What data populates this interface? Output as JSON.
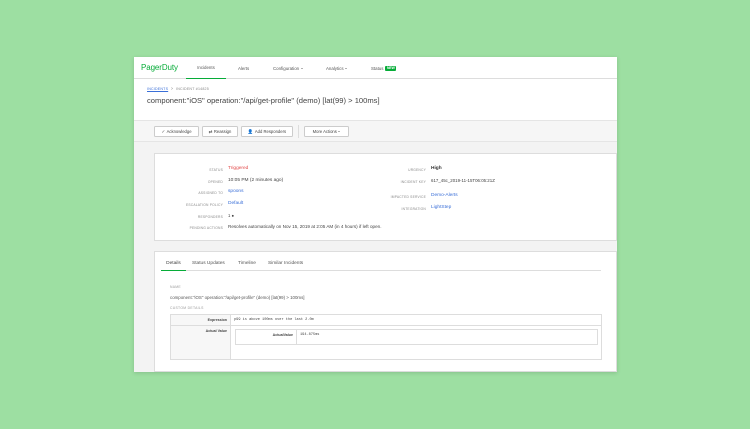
{
  "brand": {
    "name": "PagerDuty",
    "accent": "#06ac38"
  },
  "nav": {
    "items": [
      {
        "label": "Incidents",
        "dropdown": false,
        "active": true
      },
      {
        "label": "Alerts",
        "dropdown": false,
        "active": false
      },
      {
        "label": "Configuration",
        "dropdown": true,
        "active": false
      },
      {
        "label": "Analytics",
        "dropdown": true,
        "active": false
      },
      {
        "label": "Status",
        "dropdown": false,
        "active": false
      }
    ],
    "status_badge": "NEW"
  },
  "breadcrumb": {
    "parent": "INCIDENTS",
    "current": "INCIDENT #14825"
  },
  "incident": {
    "title": "component:\"iOS\" operation:\"/api/get-profile\" (demo) [lat(99) > 100ms]"
  },
  "actions": {
    "acknowledge": "Acknowledge",
    "reassign": "Reassign",
    "add_responders": "Add Responders",
    "more_actions": "More Actions"
  },
  "summary": {
    "left": [
      {
        "label": "STATUS",
        "value": "Triggered"
      },
      {
        "label": "OPENED",
        "value": "10:05 PM (2 minutes ago)"
      },
      {
        "label": "ASSIGNED TO",
        "value": "spoons"
      },
      {
        "label": "ESCALATION POLICY",
        "value": "Default"
      },
      {
        "label": "RESPONDERS",
        "value": "1"
      },
      {
        "label": "PENDING ACTIONS",
        "value": "Resolves automatically on Nov 15, 2019 at 2:05 AM (in 4 hours) if left open."
      }
    ],
    "right": [
      {
        "label": "URGENCY",
        "value": "High"
      },
      {
        "label": "INCIDENT KEY",
        "value": "617_45c_2019-11-15T06:05:21Z"
      },
      {
        "label": "IMPACTED SERVICE",
        "value": "Demo-Alerts"
      },
      {
        "label": "INTEGRATION",
        "value": "LightStep"
      }
    ]
  },
  "tabs": [
    "Details",
    "Status Updates",
    "Timeline",
    "Similar Incidents"
  ],
  "details": {
    "name_label": "NAME",
    "name_value": "component:\"iOS\" operation:\"/api/get-profile\" (demo) [lat(99) > 100ms]",
    "custom_label": "CUSTOM DETAILS",
    "rows": [
      {
        "key": "Expression",
        "value": "p99 is above 100ms over the last 2.0m"
      },
      {
        "key": "Actual Value",
        "inner_key": "ActualValue",
        "inner_value": "194.875ms"
      }
    ]
  }
}
